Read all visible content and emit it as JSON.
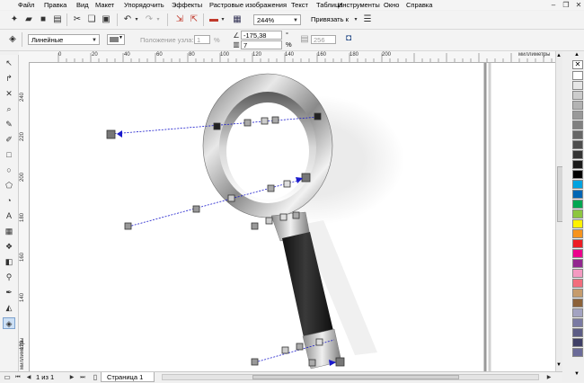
{
  "menu": [
    "Файл",
    "Правка",
    "Вид",
    "Макет",
    "Упорядочить",
    "Эффекты",
    "Растровые изображения",
    "Текст",
    "Таблица",
    "Инструменты",
    "Окно",
    "Справка"
  ],
  "standard_toolbar": {
    "zoom_value": "244%",
    "snap_label": "Привязать к"
  },
  "property_bar": {
    "style_value": "Линейные",
    "node_position_label": "Положение узла:",
    "node_position_value": "1",
    "percent_sign": "%",
    "angle_value": "-175,38",
    "angle_unit": "°",
    "edge_pad_value": "7",
    "percent2": "%",
    "steps_value": "256"
  },
  "ruler": {
    "unit_label": "миллиметры",
    "h_ticks": [
      "0",
      "20",
      "40",
      "60",
      "80",
      "100",
      "120",
      "140",
      "160",
      "180",
      "200"
    ],
    "v_ticks": [
      "240",
      "220",
      "200",
      "180",
      "160",
      "140",
      "120"
    ]
  },
  "pages": {
    "counter": "1 из 1",
    "tab_label": "Страница 1"
  },
  "colors": {
    "palette": [
      "#ffffff",
      "#e6e6e6",
      "#cccccc",
      "#b3b3b3",
      "#999999",
      "#808080",
      "#666666",
      "#4d4d4d",
      "#333333",
      "#1a1a1a",
      "#000000",
      "#00a3e0",
      "#0066b3",
      "#00a651",
      "#8dc63f",
      "#fff200",
      "#f7941d",
      "#ed1c24",
      "#ec008c",
      "#92278f",
      "#f49ac1",
      "#f26d7d",
      "#c69c6d",
      "#8c6239",
      "#a3a3c2",
      "#7a7aa3",
      "#5c5c85",
      "#3f3f66",
      "#6b6b99"
    ],
    "gradient_dash": "#1a1acc"
  }
}
